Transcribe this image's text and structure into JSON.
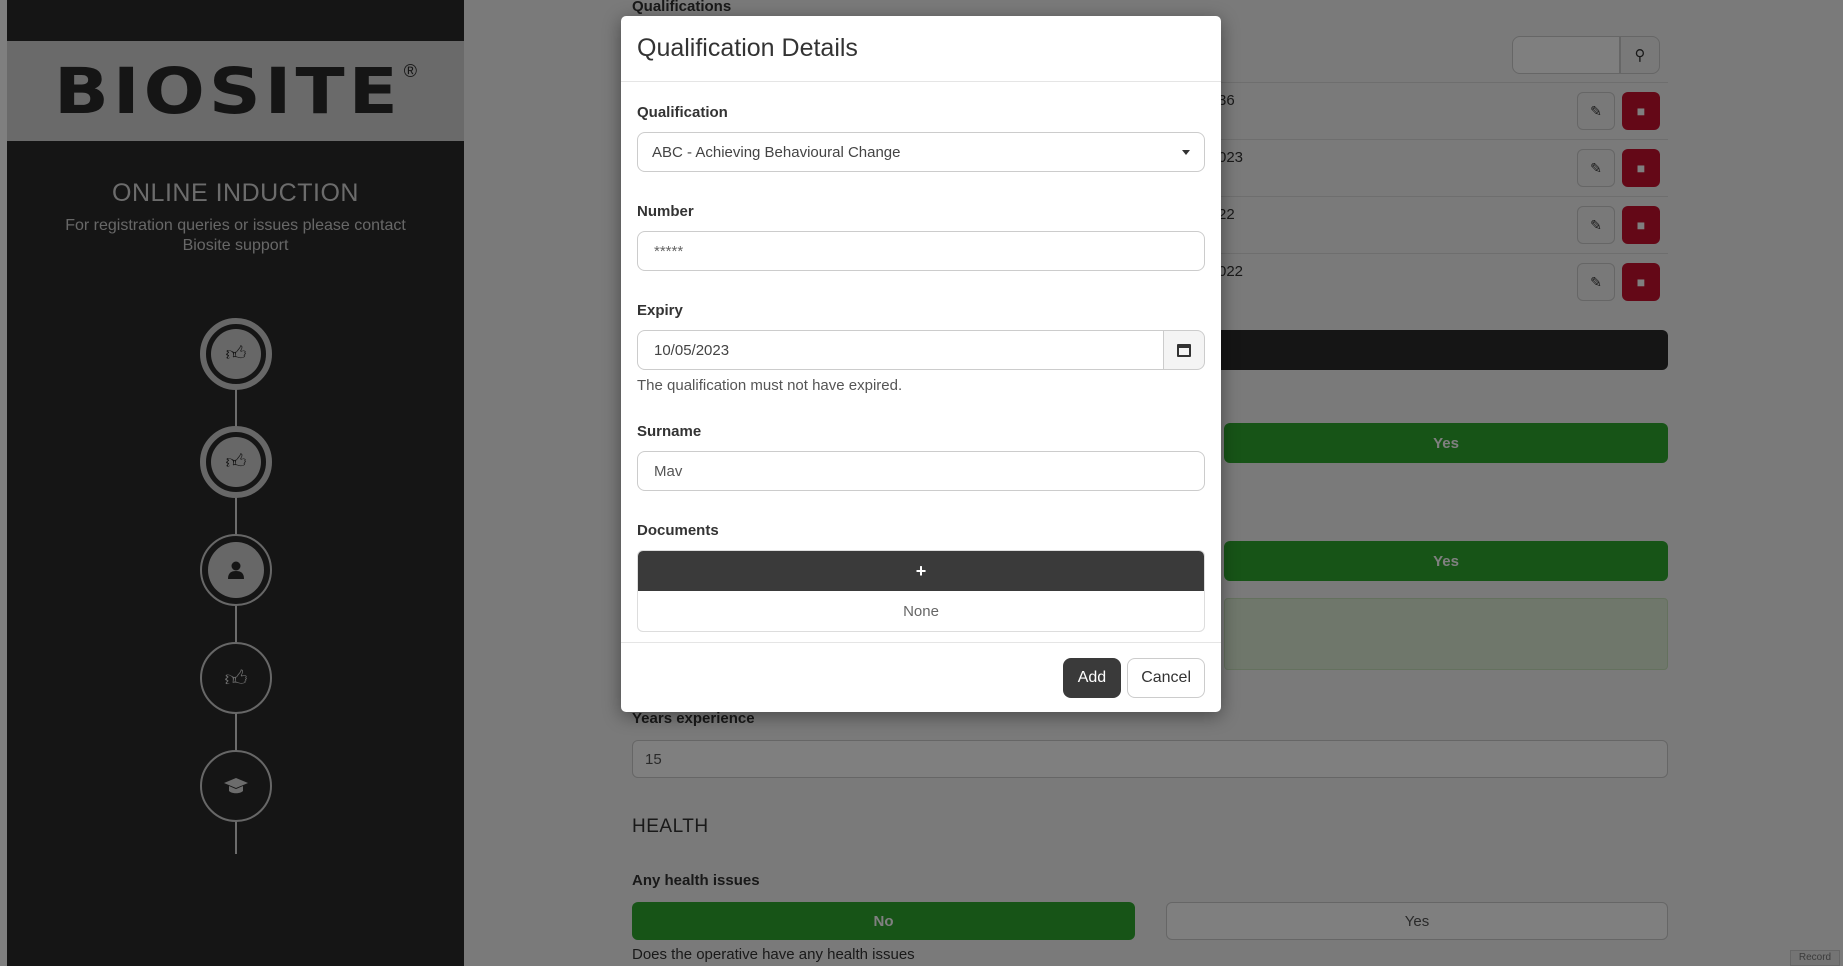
{
  "sidebar": {
    "logo_text": "BIOSITE",
    "logo_mark": "®",
    "title": "ONLINE INDUCTION",
    "subtitle": "For registration queries or issues please contact Biosite support",
    "steps": [
      {
        "icon": "thumbs-up-icon",
        "state": "done"
      },
      {
        "icon": "thumbs-up-icon",
        "state": "done"
      },
      {
        "icon": "user-icon",
        "state": "active"
      },
      {
        "icon": "thumbs-up-icon",
        "state": "pending"
      },
      {
        "icon": "graduation-cap-icon",
        "state": "pending"
      }
    ]
  },
  "background": {
    "qualifications_heading": "Qualifications",
    "row_fragments": [
      "36",
      "023",
      "22",
      "022"
    ],
    "yes_label": "Yes",
    "no_label": "No",
    "years_label": "Years experience",
    "years_value": "15",
    "health_heading": "HEALTH",
    "health_issues_label": "Any health issues",
    "health_help": "Does the operative have any health issues",
    "record_tag": "Record"
  },
  "modal": {
    "title": "Qualification Details",
    "qualification_label": "Qualification",
    "qualification_value": "ABC - Achieving Behavioural Change",
    "number_label": "Number",
    "number_placeholder": "*****",
    "expiry_label": "Expiry",
    "expiry_value": "10/05/2023",
    "expiry_help": "The qualification must not have expired.",
    "surname_label": "Surname",
    "surname_value": "Mav",
    "documents_label": "Documents",
    "documents_add": "+",
    "documents_empty": "None",
    "add_button": "Add",
    "cancel_button": "Cancel"
  },
  "colors": {
    "sidebar_bg": "#2b2b2b",
    "accent_green": "#2fa82f",
    "danger_red": "#c8102e",
    "primary_dark": "#3a3a3a"
  }
}
